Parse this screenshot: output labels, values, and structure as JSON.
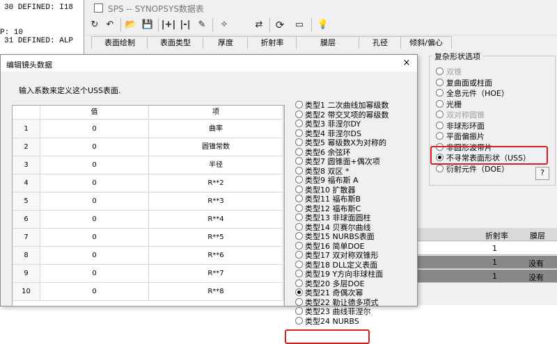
{
  "console": {
    "lines": [
      "30 DEFINED: I18",
      "P: 10",
      "31 DEFINED: ALP"
    ]
  },
  "sps_window": {
    "title": "SPS -- SYNOPSYS数据表",
    "toolbar_icons": [
      "redo-icon",
      "undo-icon",
      "open-folder-icon",
      "save-icon",
      "insert-col-icon",
      "insert-row-icon",
      "tool-icon",
      "magic-icon",
      "swap-icon",
      "refresh-icon",
      "frame-icon",
      "help-icon"
    ],
    "tabs": [
      "表面绘制",
      "表面类型",
      "厚度",
      "折射率",
      "膜层",
      "孔径",
      "倾斜/偏心"
    ],
    "complex_group": {
      "title": "复杂形状选项",
      "options": [
        {
          "label": "双锥",
          "disabled": true,
          "selected": false
        },
        {
          "label": "复曲面或柱面",
          "disabled": false,
          "selected": false
        },
        {
          "label": "全息元件（HOE）",
          "disabled": false,
          "selected": false
        },
        {
          "label": "光栅",
          "disabled": false,
          "selected": false
        },
        {
          "label": "双对称圆锥",
          "disabled": true,
          "selected": false
        },
        {
          "label": "非球形环面",
          "disabled": false,
          "selected": false
        },
        {
          "label": "平面偏振片",
          "disabled": false,
          "selected": false
        },
        {
          "label": "非圆形波带片",
          "disabled": false,
          "selected": false
        },
        {
          "label": "不寻常表面形状（USS）",
          "disabled": false,
          "selected": true
        },
        {
          "label": "衍射元件（DOE）",
          "disabled": false,
          "selected": false
        }
      ],
      "help_button": "?"
    },
    "bg_table": {
      "headers": [
        "折射率",
        "膜层"
      ],
      "rows": [
        {
          "refr": "1",
          "coat": ""
        },
        {
          "refr": "1",
          "coat": "没有"
        },
        {
          "refr": "1",
          "coat": "没有"
        }
      ]
    }
  },
  "dialog": {
    "title": "编辑镜头数据",
    "close": "×",
    "prompt": "输入系数来定义这个USS表面.",
    "table": {
      "col_value": "值",
      "col_item": "项",
      "rows": [
        {
          "n": "1",
          "v": "0",
          "item": "曲率"
        },
        {
          "n": "2",
          "v": "0",
          "item": "圆锥常数"
        },
        {
          "n": "3",
          "v": "0",
          "item": "半径"
        },
        {
          "n": "4",
          "v": "0",
          "item": "R**2"
        },
        {
          "n": "5",
          "v": "0",
          "item": "R**3"
        },
        {
          "n": "6",
          "v": "0",
          "item": "R**4"
        },
        {
          "n": "7",
          "v": "0",
          "item": "R**5"
        },
        {
          "n": "8",
          "v": "0",
          "item": "R**6"
        },
        {
          "n": "9",
          "v": "0",
          "item": "R**7"
        },
        {
          "n": "10",
          "v": "0",
          "item": "R**8"
        }
      ]
    },
    "types": [
      "类型1 二次曲线加幂级数",
      "类型2 带交叉项的幂级数",
      "类型3 菲涅尔DY",
      "类型4 菲涅尔DS",
      "类型5 幂级数X为对称的",
      "类型6 余弦环",
      "类型7 圆锥面+偶次项",
      "类型8 双区 *",
      "类型9 福布斯 A",
      "类型10 扩散器",
      "类型11 福布斯B",
      "类型12 福布斯C",
      "类型13 非球面圆柱",
      "类型14 贝赛尔曲线",
      "类型15 NURBS表面",
      "类型16 简单DOE",
      "类型17 双对称双锥形",
      "类型18 DLL定义表面",
      "类型19 Y方向非球柱面",
      "类型20 多层DOE",
      "类型21 奇偶次幂",
      "类型22 勒让德多项式",
      "类型23 曲线菲涅尔",
      "类型24 NURBS"
    ],
    "selected_type_index": 20
  }
}
